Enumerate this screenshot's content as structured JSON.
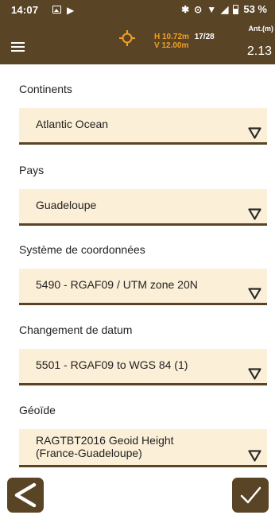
{
  "status_bar": {
    "time": "14:07",
    "battery_percent": "53 %",
    "icons": [
      "image-icon",
      "play-store-icon",
      "bluetooth-icon",
      "location-icon",
      "wifi-icon",
      "no-signal-icon",
      "battery-icon"
    ]
  },
  "app_bar": {
    "menu_icon": "hamburger-menu-icon",
    "gps_icon": "gps-crosshair-icon",
    "h_precision": "H 10.72m",
    "satellites": "17/28",
    "v_precision": "V 12.00m",
    "antenna_label": "Ant.(m)",
    "antenna_value": "2.13"
  },
  "form": {
    "fields": [
      {
        "label": "Continents",
        "value": "Atlantic Ocean"
      },
      {
        "label": "Pays",
        "value": "Guadeloupe"
      },
      {
        "label": "Système de coordonnées",
        "value": "5490 - RGAF09 / UTM zone 20N"
      },
      {
        "label": "Changement de datum",
        "value": "5501 - RGAF09 to WGS 84 (1)"
      },
      {
        "label": "Géoïde",
        "value_line1": "RAGTBT2016 Geoid Height",
        "value_line2": "(France-Guadeloupe)"
      }
    ]
  },
  "bottom_bar": {
    "back_icon": "back-arrow-icon",
    "confirm_icon": "checkmark-icon"
  },
  "colors": {
    "primary_brown": "#5a4426",
    "dropdown_bg": "#fcefd7",
    "accent_orange": "#f2a025"
  }
}
